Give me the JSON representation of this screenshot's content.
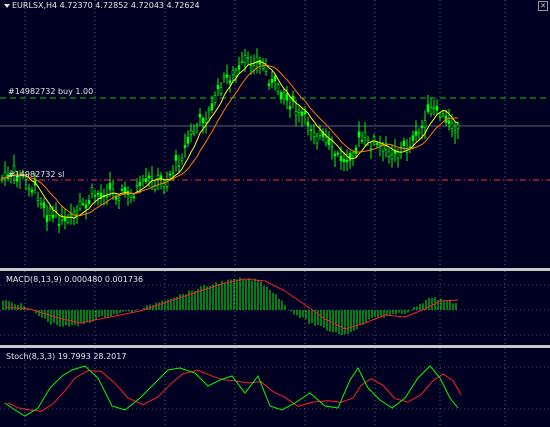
{
  "main": {
    "title": "EURLSX,H4  4.72370 4.72852 4.72043 4.72624",
    "buy_label": "#14982732 buy 1.00",
    "sl_label": "#14982732 sl",
    "colors": {
      "bg": "#000022",
      "bull": "#00ff00",
      "ma_fast": "#ffff00",
      "ma_slow": "#ff7800",
      "level_buy": "#00c800",
      "level_sl": "#ff3030",
      "grid": "#c0c0c0"
    }
  },
  "macd": {
    "label": "MACD(8,13,9) 0.000480 0.001736",
    "colors": {
      "hist": "#00ff00",
      "signal": "#ff2020"
    }
  },
  "stoch": {
    "label": "Stoch(8,3,3) 19.7993 28.2017",
    "colors": {
      "main": "#00ff00",
      "signal": "#ff2020"
    }
  }
}
